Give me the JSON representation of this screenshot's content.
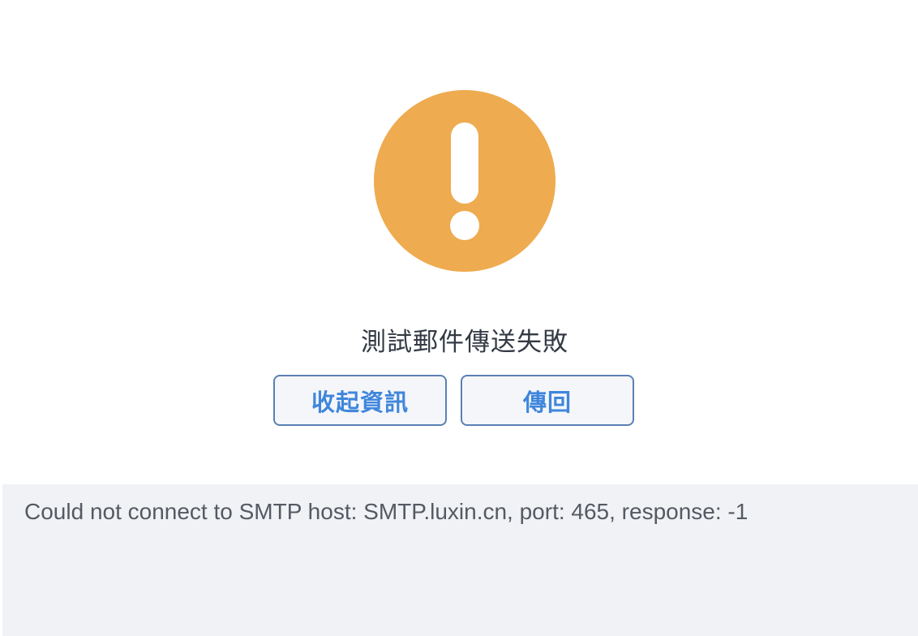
{
  "dialog": {
    "icon": "warning-exclamation-icon",
    "icon_color": "#EEAB4F",
    "title": "測試郵件傳送失敗",
    "buttons": {
      "collapse_info_label": "收起資訊",
      "back_label": "傳回"
    },
    "detail": {
      "message": "Could not connect to SMTP host: SMTP.luxin.cn, port: 465, response: -1"
    }
  },
  "colors": {
    "button_text": "#3F86DB",
    "button_border": "#5A80B4",
    "panel_background": "#F1F2F6"
  }
}
